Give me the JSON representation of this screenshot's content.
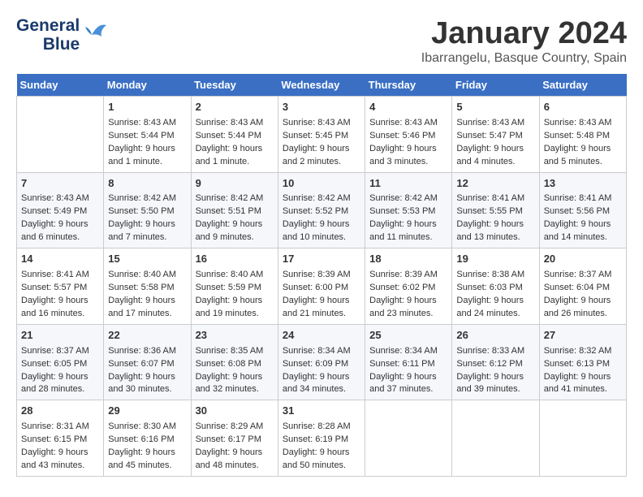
{
  "logo": {
    "line1": "General",
    "line2": "Blue"
  },
  "title": "January 2024",
  "location": "Ibarrangelu, Basque Country, Spain",
  "headers": [
    "Sunday",
    "Monday",
    "Tuesday",
    "Wednesday",
    "Thursday",
    "Friday",
    "Saturday"
  ],
  "weeks": [
    [
      {
        "day": "",
        "sunrise": "",
        "sunset": "",
        "daylight": ""
      },
      {
        "day": "1",
        "sunrise": "Sunrise: 8:43 AM",
        "sunset": "Sunset: 5:44 PM",
        "daylight": "Daylight: 9 hours and 1 minute."
      },
      {
        "day": "2",
        "sunrise": "Sunrise: 8:43 AM",
        "sunset": "Sunset: 5:44 PM",
        "daylight": "Daylight: 9 hours and 1 minute."
      },
      {
        "day": "3",
        "sunrise": "Sunrise: 8:43 AM",
        "sunset": "Sunset: 5:45 PM",
        "daylight": "Daylight: 9 hours and 2 minutes."
      },
      {
        "day": "4",
        "sunrise": "Sunrise: 8:43 AM",
        "sunset": "Sunset: 5:46 PM",
        "daylight": "Daylight: 9 hours and 3 minutes."
      },
      {
        "day": "5",
        "sunrise": "Sunrise: 8:43 AM",
        "sunset": "Sunset: 5:47 PM",
        "daylight": "Daylight: 9 hours and 4 minutes."
      },
      {
        "day": "6",
        "sunrise": "Sunrise: 8:43 AM",
        "sunset": "Sunset: 5:48 PM",
        "daylight": "Daylight: 9 hours and 5 minutes."
      }
    ],
    [
      {
        "day": "7",
        "sunrise": "Sunrise: 8:43 AM",
        "sunset": "Sunset: 5:49 PM",
        "daylight": "Daylight: 9 hours and 6 minutes."
      },
      {
        "day": "8",
        "sunrise": "Sunrise: 8:42 AM",
        "sunset": "Sunset: 5:50 PM",
        "daylight": "Daylight: 9 hours and 7 minutes."
      },
      {
        "day": "9",
        "sunrise": "Sunrise: 8:42 AM",
        "sunset": "Sunset: 5:51 PM",
        "daylight": "Daylight: 9 hours and 9 minutes."
      },
      {
        "day": "10",
        "sunrise": "Sunrise: 8:42 AM",
        "sunset": "Sunset: 5:52 PM",
        "daylight": "Daylight: 9 hours and 10 minutes."
      },
      {
        "day": "11",
        "sunrise": "Sunrise: 8:42 AM",
        "sunset": "Sunset: 5:53 PM",
        "daylight": "Daylight: 9 hours and 11 minutes."
      },
      {
        "day": "12",
        "sunrise": "Sunrise: 8:41 AM",
        "sunset": "Sunset: 5:55 PM",
        "daylight": "Daylight: 9 hours and 13 minutes."
      },
      {
        "day": "13",
        "sunrise": "Sunrise: 8:41 AM",
        "sunset": "Sunset: 5:56 PM",
        "daylight": "Daylight: 9 hours and 14 minutes."
      }
    ],
    [
      {
        "day": "14",
        "sunrise": "Sunrise: 8:41 AM",
        "sunset": "Sunset: 5:57 PM",
        "daylight": "Daylight: 9 hours and 16 minutes."
      },
      {
        "day": "15",
        "sunrise": "Sunrise: 8:40 AM",
        "sunset": "Sunset: 5:58 PM",
        "daylight": "Daylight: 9 hours and 17 minutes."
      },
      {
        "day": "16",
        "sunrise": "Sunrise: 8:40 AM",
        "sunset": "Sunset: 5:59 PM",
        "daylight": "Daylight: 9 hours and 19 minutes."
      },
      {
        "day": "17",
        "sunrise": "Sunrise: 8:39 AM",
        "sunset": "Sunset: 6:00 PM",
        "daylight": "Daylight: 9 hours and 21 minutes."
      },
      {
        "day": "18",
        "sunrise": "Sunrise: 8:39 AM",
        "sunset": "Sunset: 6:02 PM",
        "daylight": "Daylight: 9 hours and 23 minutes."
      },
      {
        "day": "19",
        "sunrise": "Sunrise: 8:38 AM",
        "sunset": "Sunset: 6:03 PM",
        "daylight": "Daylight: 9 hours and 24 minutes."
      },
      {
        "day": "20",
        "sunrise": "Sunrise: 8:37 AM",
        "sunset": "Sunset: 6:04 PM",
        "daylight": "Daylight: 9 hours and 26 minutes."
      }
    ],
    [
      {
        "day": "21",
        "sunrise": "Sunrise: 8:37 AM",
        "sunset": "Sunset: 6:05 PM",
        "daylight": "Daylight: 9 hours and 28 minutes."
      },
      {
        "day": "22",
        "sunrise": "Sunrise: 8:36 AM",
        "sunset": "Sunset: 6:07 PM",
        "daylight": "Daylight: 9 hours and 30 minutes."
      },
      {
        "day": "23",
        "sunrise": "Sunrise: 8:35 AM",
        "sunset": "Sunset: 6:08 PM",
        "daylight": "Daylight: 9 hours and 32 minutes."
      },
      {
        "day": "24",
        "sunrise": "Sunrise: 8:34 AM",
        "sunset": "Sunset: 6:09 PM",
        "daylight": "Daylight: 9 hours and 34 minutes."
      },
      {
        "day": "25",
        "sunrise": "Sunrise: 8:34 AM",
        "sunset": "Sunset: 6:11 PM",
        "daylight": "Daylight: 9 hours and 37 minutes."
      },
      {
        "day": "26",
        "sunrise": "Sunrise: 8:33 AM",
        "sunset": "Sunset: 6:12 PM",
        "daylight": "Daylight: 9 hours and 39 minutes."
      },
      {
        "day": "27",
        "sunrise": "Sunrise: 8:32 AM",
        "sunset": "Sunset: 6:13 PM",
        "daylight": "Daylight: 9 hours and 41 minutes."
      }
    ],
    [
      {
        "day": "28",
        "sunrise": "Sunrise: 8:31 AM",
        "sunset": "Sunset: 6:15 PM",
        "daylight": "Daylight: 9 hours and 43 minutes."
      },
      {
        "day": "29",
        "sunrise": "Sunrise: 8:30 AM",
        "sunset": "Sunset: 6:16 PM",
        "daylight": "Daylight: 9 hours and 45 minutes."
      },
      {
        "day": "30",
        "sunrise": "Sunrise: 8:29 AM",
        "sunset": "Sunset: 6:17 PM",
        "daylight": "Daylight: 9 hours and 48 minutes."
      },
      {
        "day": "31",
        "sunrise": "Sunrise: 8:28 AM",
        "sunset": "Sunset: 6:19 PM",
        "daylight": "Daylight: 9 hours and 50 minutes."
      },
      {
        "day": "",
        "sunrise": "",
        "sunset": "",
        "daylight": ""
      },
      {
        "day": "",
        "sunrise": "",
        "sunset": "",
        "daylight": ""
      },
      {
        "day": "",
        "sunrise": "",
        "sunset": "",
        "daylight": ""
      }
    ]
  ],
  "colors": {
    "header_bg": "#3a6fc4",
    "header_text": "#ffffff",
    "logo_blue": "#1a3a6b",
    "logo_accent": "#4a90d9"
  }
}
